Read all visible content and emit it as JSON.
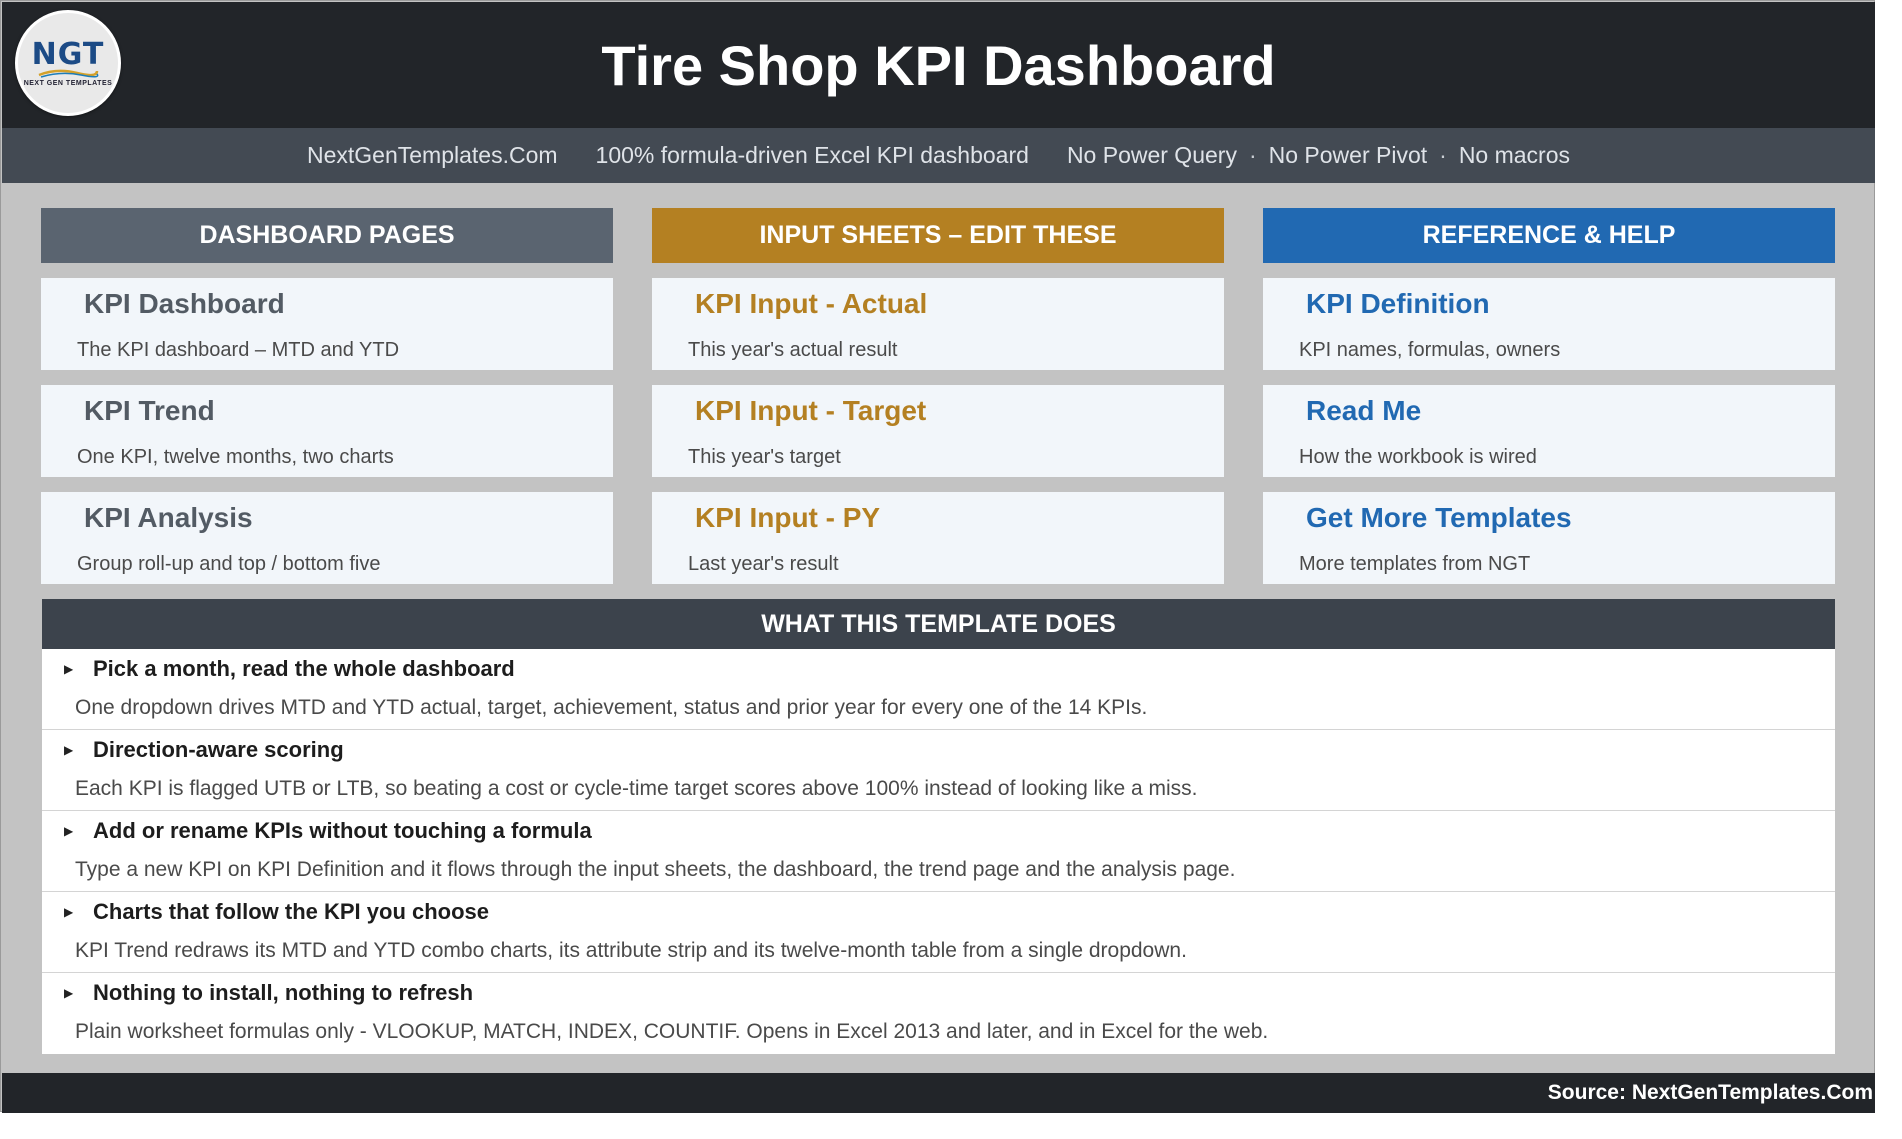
{
  "header": {
    "logo_text": "NGT",
    "logo_subtext": "NEXT GEN TEMPLATES",
    "title": "Tire Shop KPI Dashboard"
  },
  "subheader": {
    "site": "NextGenTemplates.Com",
    "tagline": "100% formula-driven Excel KPI dashboard",
    "flags": [
      "No Power Query",
      "No Power Pivot",
      "No macros"
    ],
    "separator": "·"
  },
  "columns": [
    {
      "heading": "DASHBOARD PAGES",
      "color": "#5a6470",
      "items": [
        {
          "title": "KPI Dashboard",
          "desc": "The KPI dashboard – MTD and YTD"
        },
        {
          "title": "KPI Trend",
          "desc": "One KPI, twelve months, two charts"
        },
        {
          "title": "KPI Analysis",
          "desc": "Group roll-up and top / bottom five"
        }
      ]
    },
    {
      "heading": "INPUT SHEETS – EDIT THESE",
      "color": "#b48022",
      "items": [
        {
          "title": "KPI Input - Actual",
          "desc": "This year's actual result"
        },
        {
          "title": "KPI Input - Target",
          "desc": "This year's target"
        },
        {
          "title": "KPI Input - PY",
          "desc": "Last year's result"
        }
      ]
    },
    {
      "heading": "REFERENCE & HELP",
      "color": "#2169b2",
      "items": [
        {
          "title": "KPI Definition",
          "desc": "KPI names, formulas, owners"
        },
        {
          "title": "Read Me",
          "desc": "How the workbook is wired"
        },
        {
          "title": "Get More Templates",
          "desc": "More templates from NGT"
        }
      ]
    }
  ],
  "what": {
    "heading": "WHAT THIS TEMPLATE DOES",
    "bullet_icon": "triangle-right-icon",
    "features": [
      {
        "title": "Pick a month, read the whole dashboard",
        "desc": "One dropdown drives MTD and YTD actual, target, achievement, status and prior year for every one of the 14 KPIs."
      },
      {
        "title": "Direction-aware scoring",
        "desc": "Each KPI is flagged UTB or LTB, so beating a cost or cycle-time target scores above 100% instead of looking like a miss."
      },
      {
        "title": "Add or rename KPIs without touching a formula",
        "desc": "Type a new KPI on KPI Definition and it flows through the input sheets, the dashboard, the trend page and the analysis page."
      },
      {
        "title": "Charts that follow the KPI you choose",
        "desc": "KPI Trend redraws its MTD and YTD combo charts, its attribute strip and its twelve-month table from a single dropdown."
      },
      {
        "title": "Nothing to install, nothing to refresh",
        "desc": "Plain worksheet formulas only - VLOOKUP, MATCH, INDEX, COUNTIF. Opens in Excel 2013 and later, and in Excel for the web."
      }
    ]
  },
  "footer": {
    "source": "Source: NextGenTemplates.Com"
  }
}
